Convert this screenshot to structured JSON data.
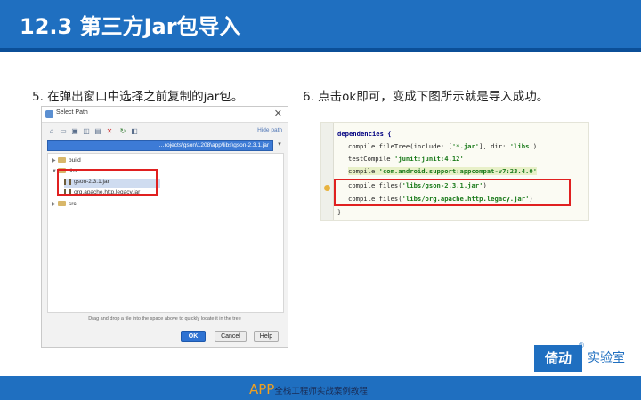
{
  "header": {
    "title": "12.3 第三方Jar包导入"
  },
  "captions": {
    "left": "5. 在弹出窗口中选择之前复制的jar包。",
    "right": "6. 点击ok即可，变成下图所示就是导入成功。"
  },
  "dialog": {
    "title": "Select Path",
    "close": "✕",
    "hide_path": "Hide path",
    "path": "…rojects\\gson\\1208\\app\\libs\\gson-2.3.1.jar",
    "tree": [
      {
        "label": "build",
        "type": "folder",
        "arrow": "▶"
      },
      {
        "label": "libs",
        "type": "folder",
        "arrow": "▼"
      },
      {
        "label": "gson-2.3.1.jar",
        "type": "jar",
        "arrow": ""
      },
      {
        "label": "org.apache.http.legacy.jar",
        "type": "jar",
        "arrow": ""
      },
      {
        "label": "src",
        "type": "folder",
        "arrow": "▶"
      }
    ],
    "hint": "Drag and drop a file into the space above to quickly locate it in the tree",
    "ok": "OK",
    "cancel": "Cancel",
    "help": "Help"
  },
  "code": {
    "line1": "dependencies {",
    "line2a": "compile fileTree(include: [",
    "line2b": "'*.jar'",
    "line2c": "], dir: ",
    "line2d": "'libs'",
    "line2e": ")",
    "line3a": "testCompile ",
    "line3b": "'junit:junit:4.12'",
    "line4a": "compile ",
    "line4b": "'com.android.support:appcompat-v7:23.4.0'",
    "line5a": "compile files(",
    "line5b": "'libs/gson-2.3.1.jar'",
    "line5c": ")",
    "line6a": "compile files(",
    "line6b": "'libs/org.apache.http.legacy.jar'",
    "line6c": ")",
    "line7": "}"
  },
  "footer": {
    "app": "APP",
    "rest": "全栈工程师实战案例教程"
  },
  "logo": {
    "main": "倚动",
    "reg": "®",
    "side": "实验室"
  }
}
